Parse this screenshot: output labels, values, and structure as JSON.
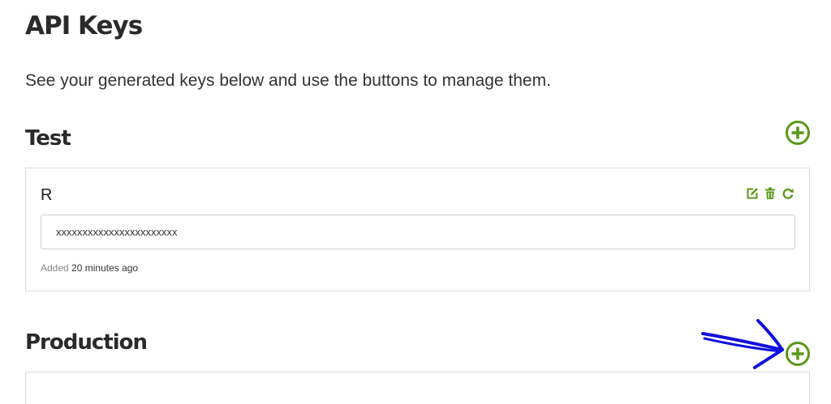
{
  "page": {
    "title": "API Keys",
    "intro": "See your generated keys below and use the buttons to manage them."
  },
  "sections": {
    "test": {
      "title": "Test",
      "add_icon": "plus-circle-icon",
      "keys": [
        {
          "name": "R",
          "value": "xxxxxxxxxxxxxxxxxxxxxxx",
          "added_label": "Added",
          "added_time": "20 minutes ago",
          "actions": [
            "edit-icon",
            "trash-icon",
            "refresh-icon"
          ]
        }
      ]
    },
    "production": {
      "title": "Production",
      "add_icon": "plus-circle-icon"
    }
  },
  "colors": {
    "accent": "#5a9a1a",
    "annotation": "#1111dd",
    "border": "#dcdcdc"
  }
}
